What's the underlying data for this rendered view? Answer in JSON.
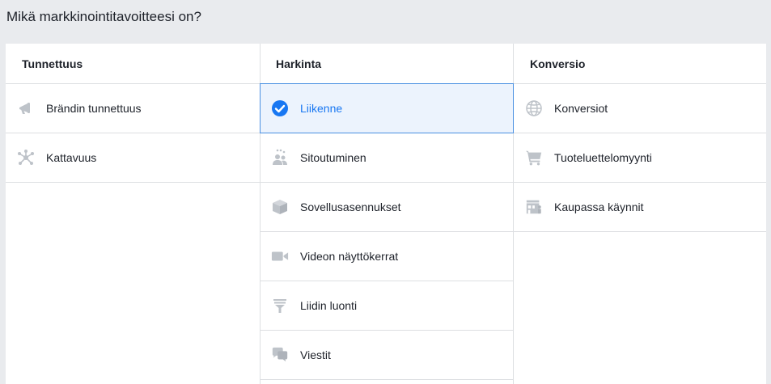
{
  "page": {
    "title": "Mikä markkinointitavoitteesi on?"
  },
  "colors": {
    "background": "#e9ebee",
    "panel": "#ffffff",
    "border": "#dddfe2",
    "selected_bg": "#ecf3fd",
    "selected_border": "#4a90e2",
    "selected_text": "#1877f2",
    "icon": "#bec3c9"
  },
  "columns": [
    {
      "header": "Tunnettuus",
      "items": [
        {
          "label": "Brändin tunnettuus",
          "icon": "megaphone-icon"
        },
        {
          "label": "Kattavuus",
          "icon": "network-icon"
        }
      ]
    },
    {
      "header": "Harkinta",
      "items": [
        {
          "label": "Liikenne",
          "icon": "check-circle-icon",
          "selected": true
        },
        {
          "label": "Sitoutuminen",
          "icon": "people-icon"
        },
        {
          "label": "Sovellusasennukset",
          "icon": "box-icon"
        },
        {
          "label": "Videon näyttökerrat",
          "icon": "video-camera-icon"
        },
        {
          "label": "Liidin luonti",
          "icon": "funnel-icon"
        },
        {
          "label": "Viestit",
          "icon": "chat-bubbles-icon"
        }
      ]
    },
    {
      "header": "Konversio",
      "items": [
        {
          "label": "Konversiot",
          "icon": "globe-icon"
        },
        {
          "label": "Tuoteluettelomyynti",
          "icon": "cart-icon"
        },
        {
          "label": "Kaupassa käynnit",
          "icon": "storefront-icon"
        }
      ]
    }
  ]
}
